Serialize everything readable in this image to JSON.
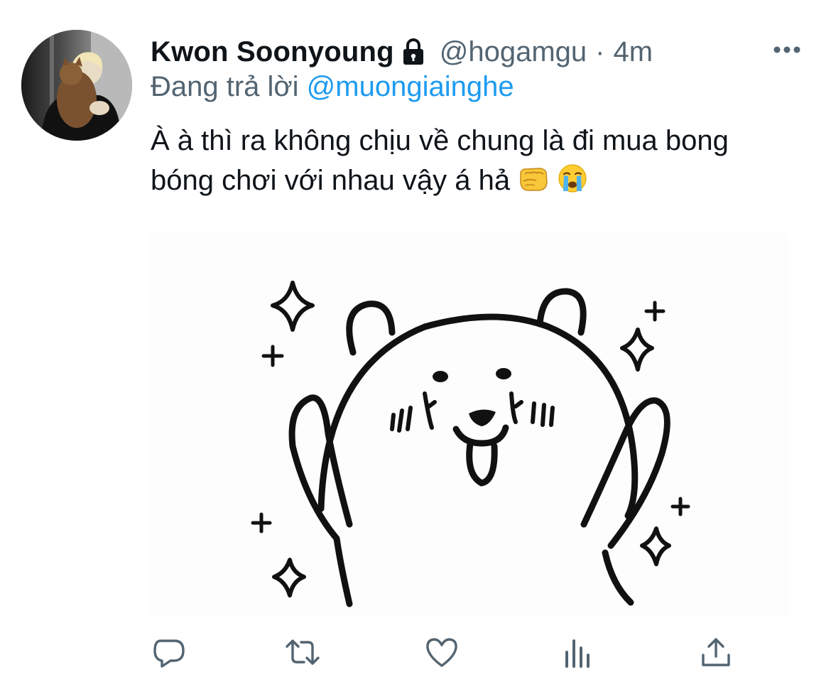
{
  "author": {
    "display_name": "Kwon Soonyoung",
    "handle": "@hogamgu",
    "separator": "·",
    "time": "4m",
    "protected_icon": "lock-icon"
  },
  "reply": {
    "prefix": "Đang trả lời ",
    "mention": "@muongiainghe"
  },
  "body": {
    "text": "À à thì ra không chịu về chung là đi mua bong bóng chơi với nhau vậy á hả",
    "emojis": [
      "fist-bump-emoji",
      "loudly-crying-face-emoji"
    ]
  },
  "media": {
    "kind": "illustration",
    "subject": "cheering white bear doodle with sparkles"
  },
  "actions": [
    {
      "name": "reply",
      "icon": "reply-icon"
    },
    {
      "name": "retweet",
      "icon": "retweet-icon"
    },
    {
      "name": "like",
      "icon": "heart-icon"
    },
    {
      "name": "analytics",
      "icon": "analytics-icon"
    },
    {
      "name": "share",
      "icon": "share-icon"
    }
  ],
  "colors": {
    "text": "#0f1419",
    "secondary": "#536471",
    "link": "#1d9bf0"
  }
}
